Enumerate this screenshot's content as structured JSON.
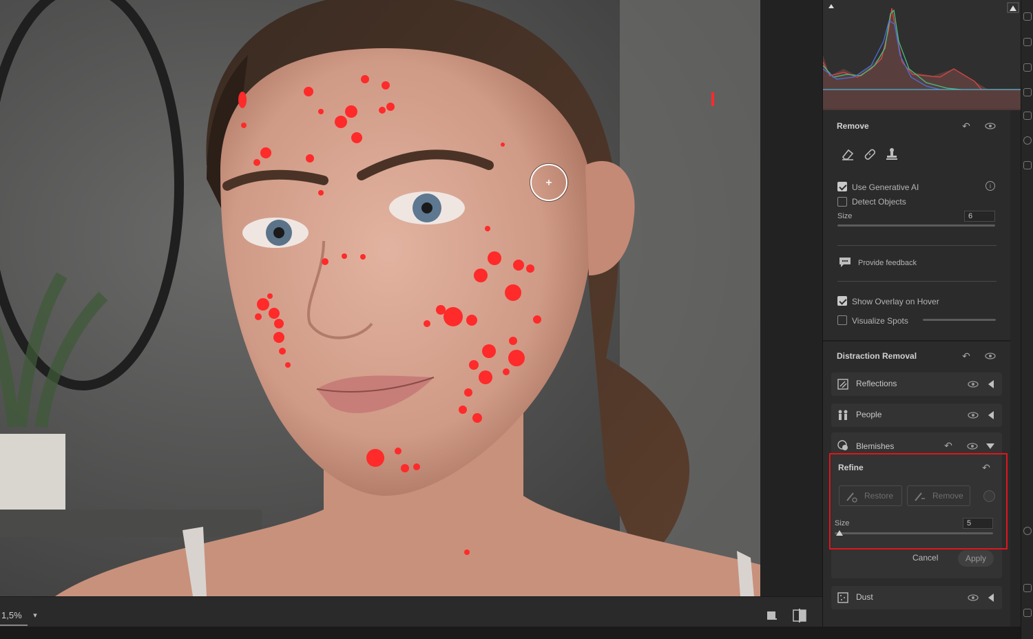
{
  "canvas": {
    "cursor": "brush-crosshair-icon",
    "overlay_color": "#ff2a2a"
  },
  "bottombar": {
    "zoom": "1,5%"
  },
  "remove": {
    "title": "Remove",
    "tools": [
      "eraser-icon",
      "bandage-icon",
      "stamp-icon"
    ],
    "use_gen_ai": {
      "label": "Use Generative AI",
      "checked": true
    },
    "detect_objects": {
      "label": "Detect Objects",
      "checked": false
    },
    "size_label": "Size",
    "size_value": "6",
    "feedback": "Provide feedback",
    "show_overlay": {
      "label": "Show Overlay on Hover",
      "checked": true
    },
    "visualize_spots": {
      "label": "Visualize Spots",
      "checked": false
    }
  },
  "distraction": {
    "title": "Distraction Removal",
    "items": [
      {
        "label": "Reflections"
      },
      {
        "label": "People"
      },
      {
        "label": "Blemishes"
      },
      {
        "label": "Dust"
      }
    ]
  },
  "refine": {
    "title": "Refine",
    "restore_label": "Restore",
    "remove_label": "Remove",
    "size_label": "Size",
    "size_value": "5",
    "cancel_label": "Cancel",
    "apply_label": "Apply",
    "highlight_color": "#e0161b"
  }
}
